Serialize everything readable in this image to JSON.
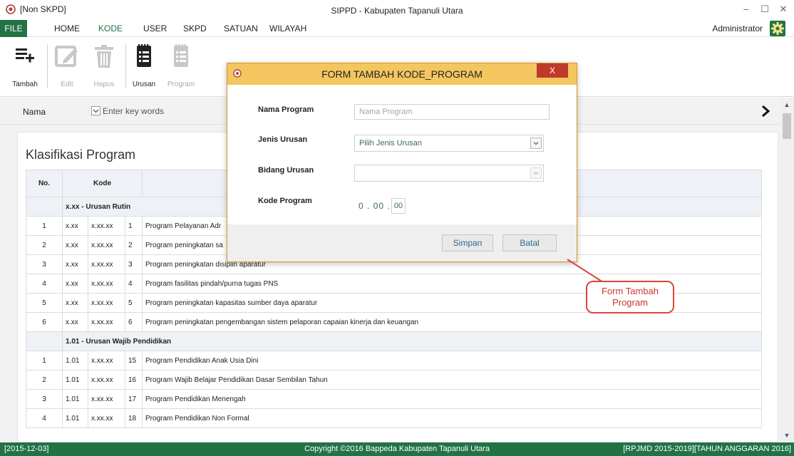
{
  "window": {
    "tag": "[Non SKPD]",
    "title": "SIPPD - Kabupaten Tapanuli Utara"
  },
  "menu": {
    "items": [
      "FILE",
      "HOME",
      "KODE",
      "USER",
      "SKPD",
      "SATUAN",
      "WILAYAH"
    ],
    "active": "KODE",
    "user": "Administrator"
  },
  "ribbon": {
    "tambah": "Tambah",
    "edit": "Edit",
    "hapus": "Hapus",
    "urusan": "Urusan",
    "program": "Program"
  },
  "search": {
    "field": "Nama",
    "placeholder": "Enter key words"
  },
  "main": {
    "title": "Klasifikasi Program",
    "headers": {
      "no": "No.",
      "kode": "Kode"
    },
    "groups": [
      {
        "label": "x.xx - Urusan Rutin",
        "rows": [
          {
            "no": "1",
            "c1": "x.xx",
            "c2": "x.xx.xx",
            "c3": "1",
            "name": "Program Pelayanan Adr"
          },
          {
            "no": "2",
            "c1": "x.xx",
            "c2": "x.xx.xx",
            "c3": "2",
            "name": "Program peningkatan sa"
          },
          {
            "no": "3",
            "c1": "x.xx",
            "c2": "x.xx.xx",
            "c3": "3",
            "name": "Program peningkatan disiplin aparatur"
          },
          {
            "no": "4",
            "c1": "x.xx",
            "c2": "x.xx.xx",
            "c3": "4",
            "name": "Program fasilitas pindah/purna tugas PNS"
          },
          {
            "no": "5",
            "c1": "x.xx",
            "c2": "x.xx.xx",
            "c3": "5",
            "name": "Program peningkatan kapasitas sumber daya aparatur"
          },
          {
            "no": "6",
            "c1": "x.xx",
            "c2": "x.xx.xx",
            "c3": "6",
            "name": "Program peningkatan pengembangan sistem pelaporan capaian kinerja dan keuangan"
          }
        ]
      },
      {
        "label": "1.01 - Urusan Wajib Pendidikan",
        "rows": [
          {
            "no": "1",
            "c1": "1.01",
            "c2": "x.xx.xx",
            "c3": "15",
            "name": "Program Pendidikan Anak Usia Dini"
          },
          {
            "no": "2",
            "c1": "1.01",
            "c2": "x.xx.xx",
            "c3": "16",
            "name": "Program Wajib Belajar Pendidikan Dasar Sembilan Tahun"
          },
          {
            "no": "3",
            "c1": "1.01",
            "c2": "x.xx.xx",
            "c3": "17",
            "name": "Program Pendidikan Menengah"
          },
          {
            "no": "4",
            "c1": "1.01",
            "c2": "x.xx.xx",
            "c3": "18",
            "name": "Program Pendidikan Non Formal"
          }
        ]
      }
    ]
  },
  "dialog": {
    "title": "FORM TAMBAH KODE_PROGRAM",
    "close": "X",
    "nama_label": "Nama Program",
    "nama_placeholder": "Nama Program",
    "jenis_label": "Jenis Urusan",
    "jenis_value": "Pilih Jenis Urusan",
    "bidang_label": "Bidang Urusan",
    "bidang_value": "",
    "kode_label": "Kode Program",
    "kode_prefix": "0 . 00 .",
    "kode_value": "00",
    "simpan": "Simpan",
    "batal": "Batal"
  },
  "callout": {
    "line1": "Form Tambah",
    "line2": "Program"
  },
  "status": {
    "date": "[2015-12-03]",
    "copyright": "Copyright ©2016 Bappeda Kabupaten Tapanuli Utara",
    "period": "[RPJMD 2015-2019][TAHUN ANGGARAN 2016]"
  },
  "colors": {
    "accent": "#217346",
    "dialog_header": "#f3c65f",
    "close_button": "#c0392b",
    "callout": "#d9453a"
  }
}
